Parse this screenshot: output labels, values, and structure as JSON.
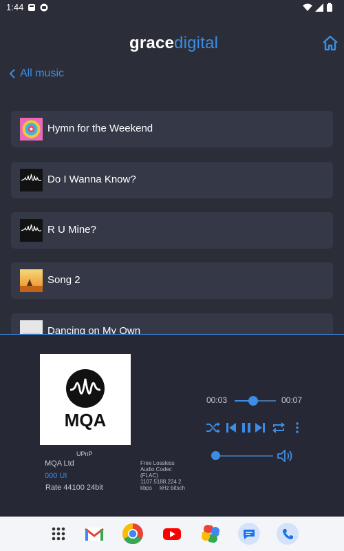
{
  "status_bar": {
    "time": "1:44"
  },
  "header": {
    "logo_part1": "grace",
    "logo_part2": "digital"
  },
  "nav": {
    "back_label": "All music"
  },
  "songs": [
    {
      "title": "Hymn for the Weekend",
      "art": "colorful-album-art"
    },
    {
      "title": "Do I Wanna Know?",
      "art": "soundwave-album-art"
    },
    {
      "title": "R U Mine?",
      "art": "soundwave-album-art"
    },
    {
      "title": "Song 2",
      "art": "sunset-album-art"
    },
    {
      "title": "Dancing on My Own",
      "art": "light-album-art"
    }
  ],
  "player": {
    "cover_text": "MQA",
    "source": "UPnP",
    "label": "MQA Ltd",
    "ui": "000 UI",
    "rate": "Rate 44100 24bit",
    "codec_lines": [
      "Free Lossless",
      "Audio Codec",
      "(FLAC)",
      "1107.5188.224  2",
      "kbps     kHz bitsch"
    ],
    "elapsed": "00:03",
    "duration": "00:07",
    "progress": 0.45,
    "volume": 0.0
  },
  "dock": [
    "apps-grid-icon",
    "gmail-icon",
    "chrome-icon",
    "youtube-icon",
    "photos-icon",
    "messages-icon",
    "phone-icon"
  ],
  "colors": {
    "background": "#2b2e38",
    "row": "#353947",
    "accent": "#3b8de6",
    "player_bg": "#262935",
    "navbar": "#f4f5f8"
  }
}
